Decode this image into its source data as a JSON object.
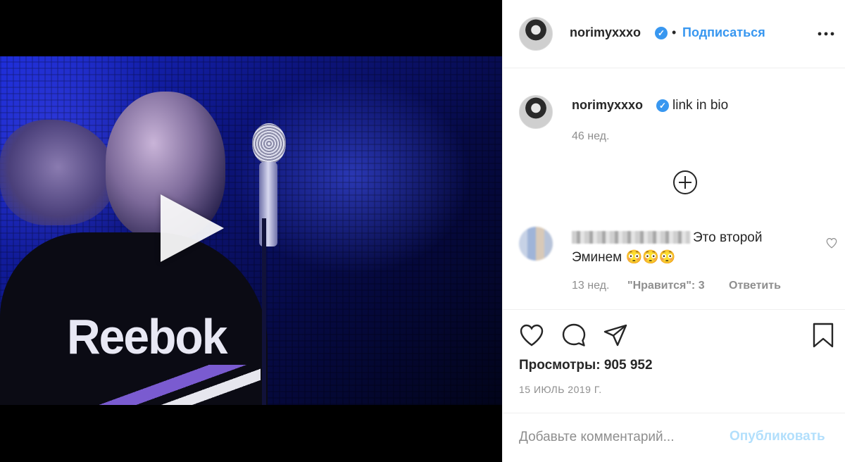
{
  "post": {
    "username": "norimyxxxo",
    "verified_mark": "✓",
    "separator": "•",
    "follow_label": "Подписаться",
    "caption": "link in bio",
    "caption_time": "46 нед.",
    "video_brand_text": "Reebok"
  },
  "comment": {
    "text": "Это второй Эминем 😳😳😳",
    "time": "13 нед.",
    "likes": "\"Нравится\": 3",
    "reply_label": "Ответить"
  },
  "stats": {
    "views": "Просмотры: 905 952",
    "date": "15 ИЮЛЬ 2019 Г."
  },
  "composer": {
    "placeholder": "Добавьте комментарий...",
    "post_label": "Опубликовать"
  },
  "icons": {
    "more": "more-options-icon",
    "expand": "plus-circle-icon",
    "like": "heart-icon",
    "comment": "comment-icon",
    "share": "share-icon",
    "save": "bookmark-icon",
    "play": "play-icon"
  },
  "colors": {
    "link_blue": "#3897f0",
    "post_disabled": "#b2dffc",
    "muted_text": "#8e8e8e",
    "primary_text": "#262626"
  }
}
